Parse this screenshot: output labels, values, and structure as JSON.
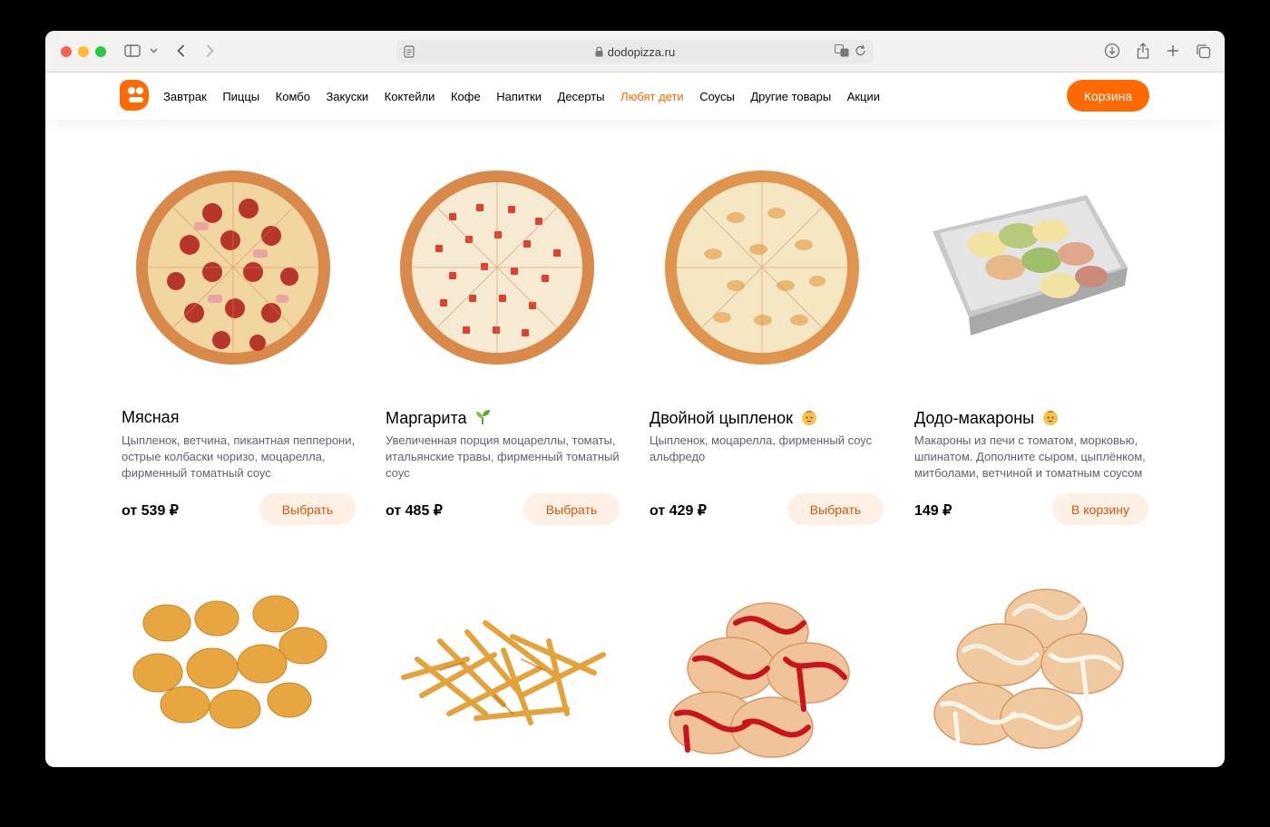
{
  "browser": {
    "url": "dodopizza.ru"
  },
  "nav": {
    "items": [
      {
        "label": "Завтрак"
      },
      {
        "label": "Пиццы"
      },
      {
        "label": "Комбо"
      },
      {
        "label": "Закуски"
      },
      {
        "label": "Коктейли"
      },
      {
        "label": "Кофе"
      },
      {
        "label": "Напитки"
      },
      {
        "label": "Десерты"
      },
      {
        "label": "Любят дети",
        "accent": true
      },
      {
        "label": "Соусы"
      },
      {
        "label": "Другие товары"
      },
      {
        "label": "Акции"
      }
    ],
    "cart_label": "Корзина",
    "accent_color": "#ff6900"
  },
  "products": [
    {
      "name": "Мясная",
      "badge_icon": "",
      "description": "Цыпленок, ветчина, пикантная пепперони, острые колбаски чоризо, моцарелла, фирменный томатный соус",
      "price": "от 539 ₽",
      "button": "Выбрать",
      "image_icon": "pizza-meat-image"
    },
    {
      "name": "Маргарита",
      "badge_icon": "sprout-icon",
      "description": "Увеличенная порция моцареллы, томаты, итальянские травы, фирменный томатный соус",
      "price": "от 485 ₽",
      "button": "Выбрать",
      "image_icon": "pizza-margherita-image"
    },
    {
      "name": "Двойной цыпленок",
      "badge_icon": "baby-icon",
      "description": "Цыпленок, моцарелла, фирменный соус альфредо",
      "price": "от 429 ₽",
      "button": "Выбрать",
      "image_icon": "pizza-chicken-image"
    },
    {
      "name": "Додо-макароны",
      "badge_icon": "baby-icon",
      "description": "Макароны из печи с томатом, морковью, шпинатом. Дополните сыром, цыплёнком, митболами, ветчиной и томатным соусом",
      "price": "149 ₽",
      "button": "В корзину",
      "image_icon": "pasta-tray-image"
    }
  ],
  "second_row_images": [
    "nuggets-image",
    "fries-image",
    "syrniki-jam-image",
    "syrniki-condensed-milk-image"
  ]
}
